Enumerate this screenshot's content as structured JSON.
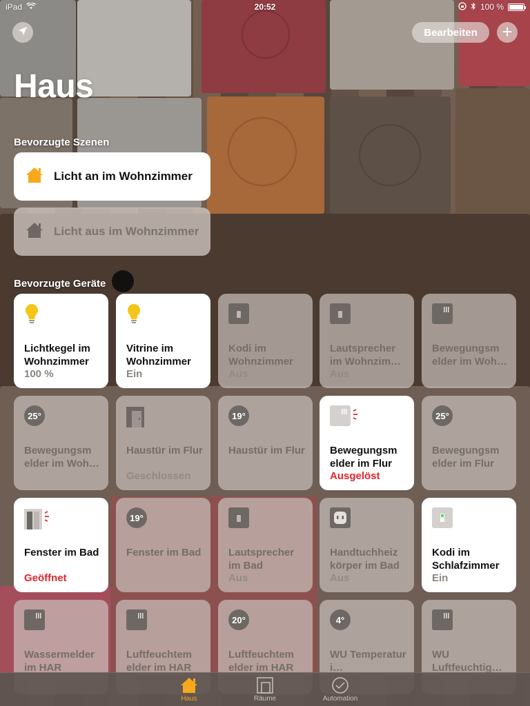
{
  "status_bar": {
    "device": "iPad",
    "time": "20:52",
    "battery": "100 %"
  },
  "header": {
    "edit_label": "Bearbeiten",
    "add_label": "+",
    "title": "Haus"
  },
  "scenes": {
    "title": "Bevorzugte Szenen",
    "items": [
      {
        "label": "Licht an im Wohnzimmer",
        "active": true
      },
      {
        "label": "Licht aus im Wohnzimmer",
        "active": false
      }
    ]
  },
  "devices": {
    "title": "Bevorzugte Geräte",
    "items": [
      {
        "name": "Lichtkegel im Wohnzimmer",
        "state": "100 %",
        "icon": "bulb-icon",
        "on": true
      },
      {
        "name": "Vitrine im Wohnzimmer",
        "state": "Ein",
        "icon": "bulb-icon",
        "on": true
      },
      {
        "name": "Kodi im Wohnzimmer",
        "state": "Aus",
        "icon": "switch-icon",
        "on": false
      },
      {
        "name": "Lautsprecher im Wohnzim…",
        "state": "Aus",
        "icon": "switch-icon",
        "on": false
      },
      {
        "name": "Bewegungsm elder im Woh…",
        "state": "",
        "icon": "motion-sensor-icon",
        "on": false
      },
      {
        "name": "Bewegungsm elder im Woh…",
        "state": "",
        "icon": "temperature-icon",
        "temp": "25°",
        "on": false
      },
      {
        "name": "Haustür im Flur",
        "state": "Geschlossen",
        "icon": "door-icon",
        "on": false
      },
      {
        "name": "Haustür im Flur",
        "state": "",
        "icon": "temperature-icon",
        "temp": "19°",
        "on": false
      },
      {
        "name": "Bewegungsm elder im Flur",
        "state": "Ausgelöst",
        "icon": "motion-sensor-icon",
        "on": true,
        "alert": true
      },
      {
        "name": "Bewegungsm elder im Flur",
        "state": "",
        "icon": "temperature-icon",
        "temp": "25°",
        "on": false
      },
      {
        "name": "Fenster im Bad",
        "state": "Geöffnet",
        "icon": "window-icon",
        "on": true,
        "alert": true
      },
      {
        "name": "Fenster im Bad",
        "state": "",
        "icon": "temperature-icon",
        "temp": "19°",
        "on": false
      },
      {
        "name": "Lautsprecher im Bad",
        "state": "Aus",
        "icon": "switch-icon",
        "on": false
      },
      {
        "name": "Handtuchheiz körper im Bad",
        "state": "Aus",
        "icon": "outlet-icon",
        "on": false
      },
      {
        "name": "Kodi im Schlafzimmer",
        "state": "Ein",
        "icon": "switch-icon",
        "on": true
      },
      {
        "name": "Wassermelder im HAR",
        "state": "",
        "icon": "sensor-icon",
        "on": false
      },
      {
        "name": "Luftfeuchtem elder im HAR",
        "state": "",
        "icon": "sensor-icon",
        "on": false
      },
      {
        "name": "Luftfeuchtem elder im HAR",
        "state": "",
        "icon": "temperature-icon",
        "temp": "20°",
        "on": false
      },
      {
        "name": "WU Temperatur i…",
        "state": "",
        "icon": "temperature-icon",
        "temp": "4°",
        "on": false
      },
      {
        "name": "WU Luftfeuchtig…",
        "state": "",
        "icon": "sensor-icon",
        "on": false
      }
    ]
  },
  "tabbar": {
    "tabs": [
      {
        "label": "Haus",
        "active": true
      },
      {
        "label": "Räume",
        "active": false
      },
      {
        "label": "Automation",
        "active": false
      }
    ]
  },
  "colors": {
    "accent": "#f7a81b",
    "alert": "#e3242b",
    "bulb": "#f5c518"
  }
}
